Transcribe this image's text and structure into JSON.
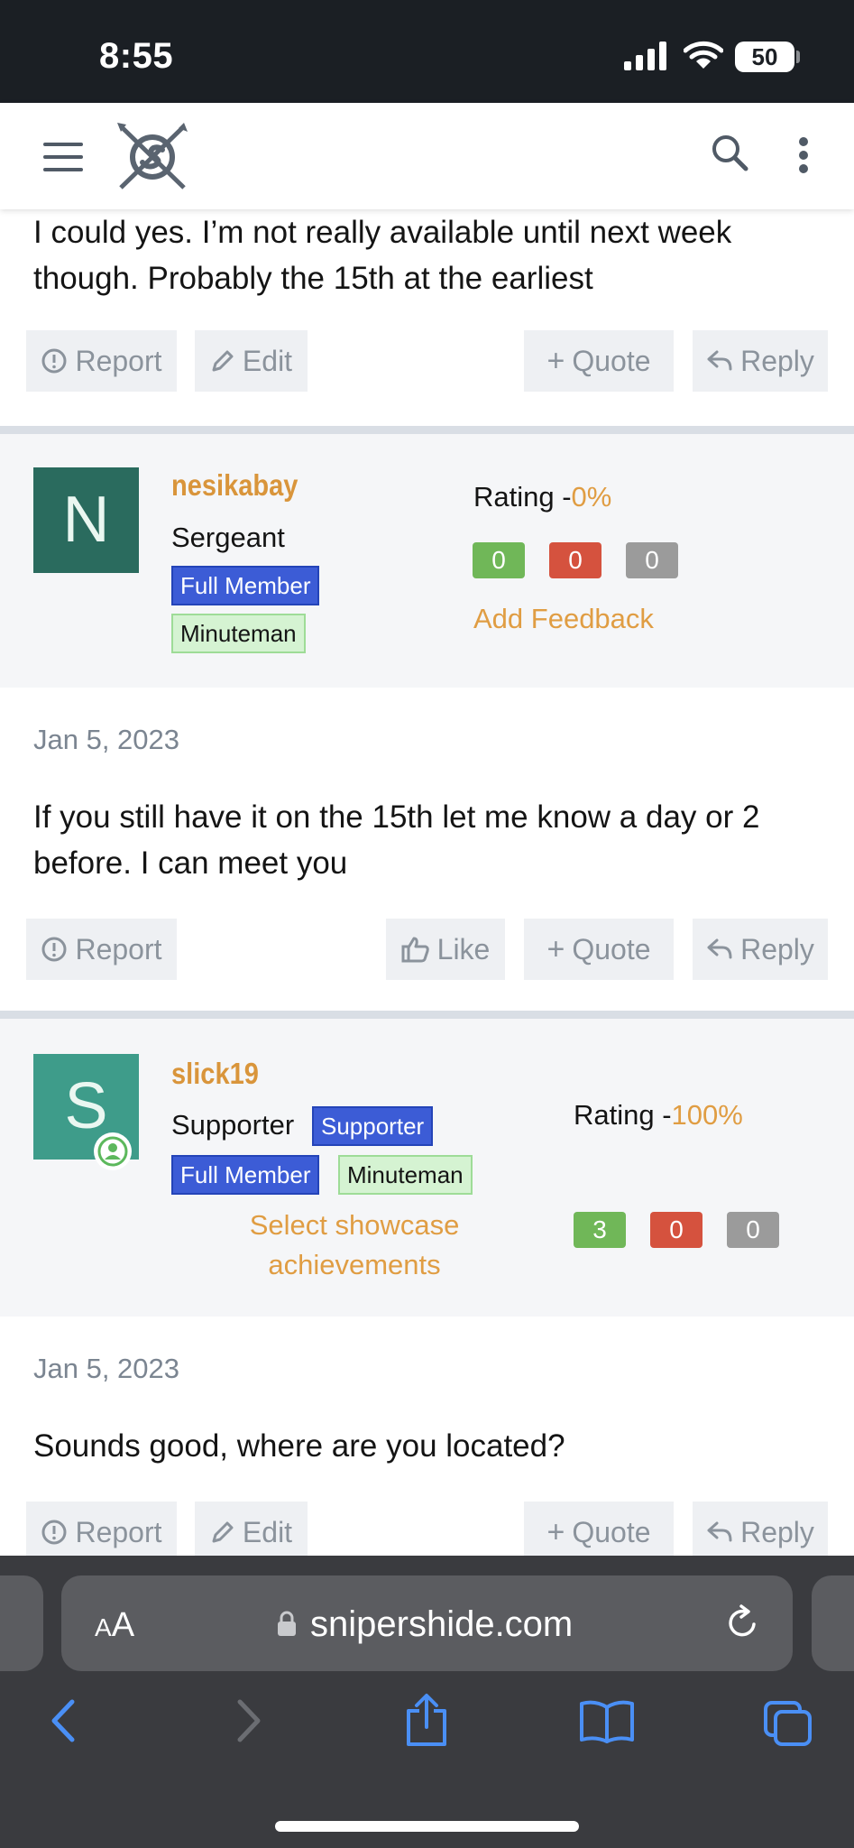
{
  "status_bar": {
    "time": "8:55",
    "battery": "50"
  },
  "post_top": {
    "text": "I could yes. I’m not really available until next week though. Probably the 15th at the earliest",
    "actions": {
      "report": "Report",
      "edit": "Edit",
      "quote": "Quote",
      "reply": "Reply"
    }
  },
  "user1": {
    "initial": "N",
    "avatar_color": "#2a6b5e",
    "name": "nesikabay",
    "title": "Sergeant",
    "badges": [
      "Full Member",
      "Minuteman"
    ],
    "rating_label": "Rating -",
    "rating_pct": "0%",
    "feedback": [
      "0",
      "0",
      "0"
    ],
    "add_feedback": "Add Feedback"
  },
  "post1": {
    "date": "Jan 5, 2023",
    "text": "If you still have it on the 15th let me know a day or 2 before. I can meet you",
    "actions": {
      "report": "Report",
      "like": "Like",
      "quote": "Quote",
      "reply": "Reply"
    }
  },
  "user2": {
    "initial": "S",
    "avatar_color": "#3e9c8a",
    "name": "slick19",
    "title": "Supporter",
    "badges": [
      "Supporter",
      "Full Member",
      "Minuteman"
    ],
    "showcase": [
      "Select showcase",
      "achievements"
    ],
    "rating_label": "Rating -",
    "rating_pct": "100%",
    "feedback": [
      "3",
      "0",
      "0"
    ]
  },
  "post2": {
    "date": "Jan 5, 2023",
    "text": "Sounds good, where are you located?",
    "actions": {
      "report": "Report",
      "edit": "Edit",
      "quote": "Quote",
      "reply": "Reply"
    }
  },
  "browser": {
    "aa_big": "A",
    "aa_small": "A",
    "url": "snipershide.com"
  }
}
